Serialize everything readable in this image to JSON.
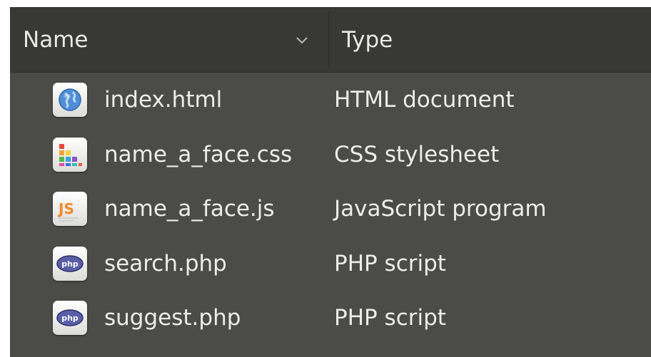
{
  "columns": {
    "name_label": "Name",
    "type_label": "Type"
  },
  "files": [
    {
      "name": "index.html",
      "type": "HTML document",
      "icon": "html-globe-icon"
    },
    {
      "name": "name_a_face.css",
      "type": "CSS stylesheet",
      "icon": "css-stylesheet-icon"
    },
    {
      "name": "name_a_face.js",
      "type": "JavaScript program",
      "icon": "javascript-icon"
    },
    {
      "name": "search.php",
      "type": "PHP script",
      "icon": "php-icon"
    },
    {
      "name": "suggest.php",
      "type": "PHP script",
      "icon": "php-icon"
    }
  ],
  "colors": {
    "background": "#4b4b47",
    "header": "#383835",
    "text": "#ececea"
  }
}
